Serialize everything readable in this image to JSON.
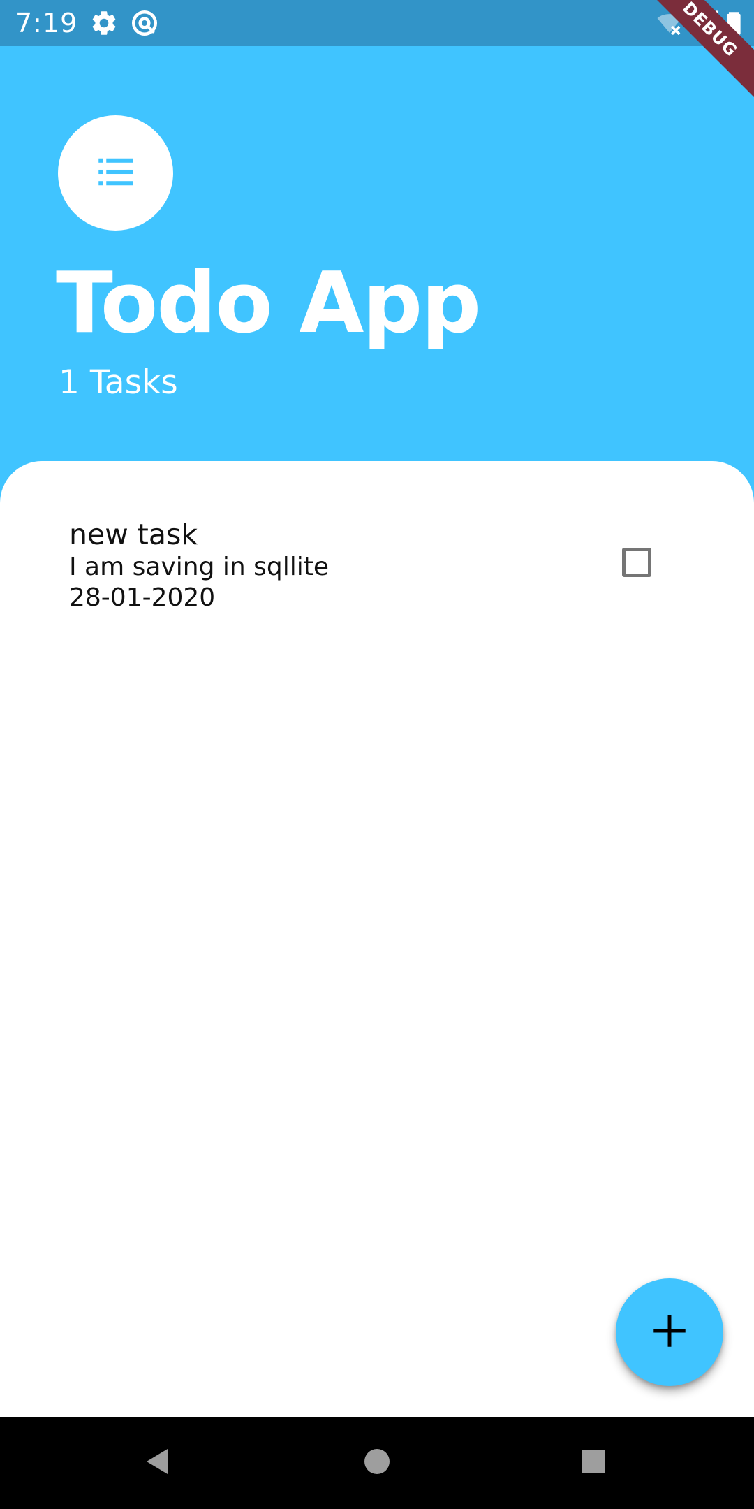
{
  "status_bar": {
    "time": "7:19",
    "icons": [
      "settings-icon",
      "sync-icon",
      "wifi-off-icon",
      "signal-icon",
      "battery-icon"
    ],
    "debug_label": "DEBUG"
  },
  "header": {
    "icon": "list-icon",
    "title": "Todo App",
    "task_count": "1 Tasks"
  },
  "tasks": [
    {
      "title": "new task",
      "description": "I am saving in sqllite",
      "date": "28-01-2020",
      "checked": false
    }
  ],
  "fab": {
    "icon": "add-icon"
  },
  "nav_bar": {
    "icons": [
      "back-icon",
      "home-icon",
      "recents-icon"
    ]
  },
  "colors": {
    "primary": "#40c4ff",
    "status_bar": "#3294c8",
    "debug_banner": "#7b2d3b",
    "panel": "#ffffff",
    "nav_bar": "#000000"
  }
}
